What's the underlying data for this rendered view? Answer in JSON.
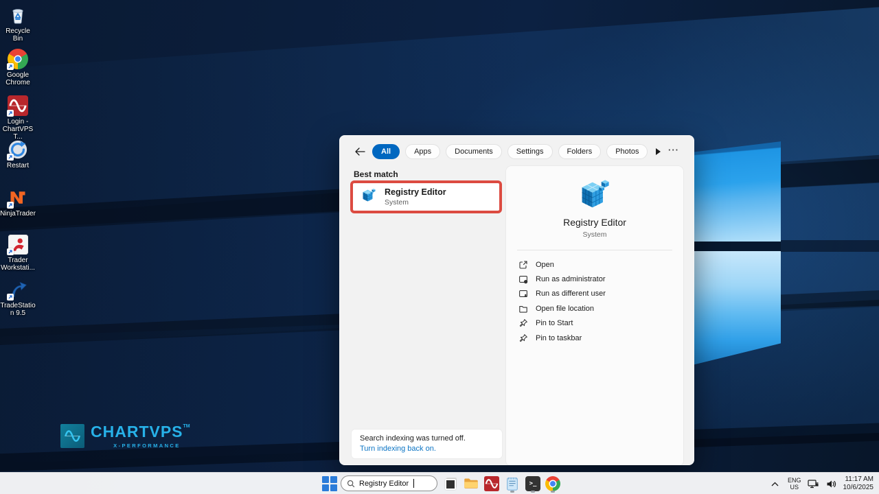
{
  "colors": {
    "accent": "#0067c0",
    "highlight_red": "#dc4b41",
    "link_blue": "#0b74c4",
    "watermark_cyan": "#27b1e8"
  },
  "desktop": {
    "icons": [
      {
        "label": "Recycle Bin",
        "icon": "recycle-bin-icon"
      },
      {
        "label": "Google Chrome",
        "icon": "chrome-icon"
      },
      {
        "label": "Login - ChartVPS T...",
        "icon": "chartvps-login-icon"
      },
      {
        "label": "Restart",
        "icon": "restart-icon"
      },
      {
        "label": "NinjaTrader",
        "icon": "ninjatrader-icon"
      },
      {
        "label": "Trader Workstati...",
        "icon": "trader-workstation-icon"
      },
      {
        "label": "TradeStation 9.5",
        "icon": "tradestation-icon"
      }
    ],
    "watermark": {
      "brand": "CHARTVPS",
      "tm": "TM",
      "tagline": "X-PERFORMANCE"
    }
  },
  "search_panel": {
    "tabs": [
      {
        "label": "All",
        "selected": true
      },
      {
        "label": "Apps",
        "selected": false
      },
      {
        "label": "Documents",
        "selected": false
      },
      {
        "label": "Settings",
        "selected": false
      },
      {
        "label": "Folders",
        "selected": false
      },
      {
        "label": "Photos",
        "selected": false
      }
    ],
    "overflow_label": "···",
    "best_match_header": "Best match",
    "best_match": {
      "title": "Registry Editor",
      "subtitle": "System"
    },
    "preview": {
      "title": "Registry Editor",
      "subtitle": "System"
    },
    "actions": [
      {
        "label": "Open",
        "icon": "open-external-icon"
      },
      {
        "label": "Run as administrator",
        "icon": "run-admin-icon"
      },
      {
        "label": "Run as different user",
        "icon": "run-different-user-icon"
      },
      {
        "label": "Open file location",
        "icon": "open-file-location-icon"
      },
      {
        "label": "Pin to Start",
        "icon": "pin-icon"
      },
      {
        "label": "Pin to taskbar",
        "icon": "pin-icon"
      }
    ],
    "indexing_notice": {
      "message": "Search indexing was turned off.",
      "link_label": "Turn indexing back on."
    }
  },
  "taskbar": {
    "search": {
      "value": "Registry Editor"
    },
    "apps": [
      "task-view",
      "file-explorer",
      "chartvps-app",
      "notepad",
      "terminal",
      "chrome"
    ],
    "tray": {
      "language_line1": "ENG",
      "language_line2": "US",
      "time": "11:17 AM",
      "date": "10/6/2025"
    }
  }
}
